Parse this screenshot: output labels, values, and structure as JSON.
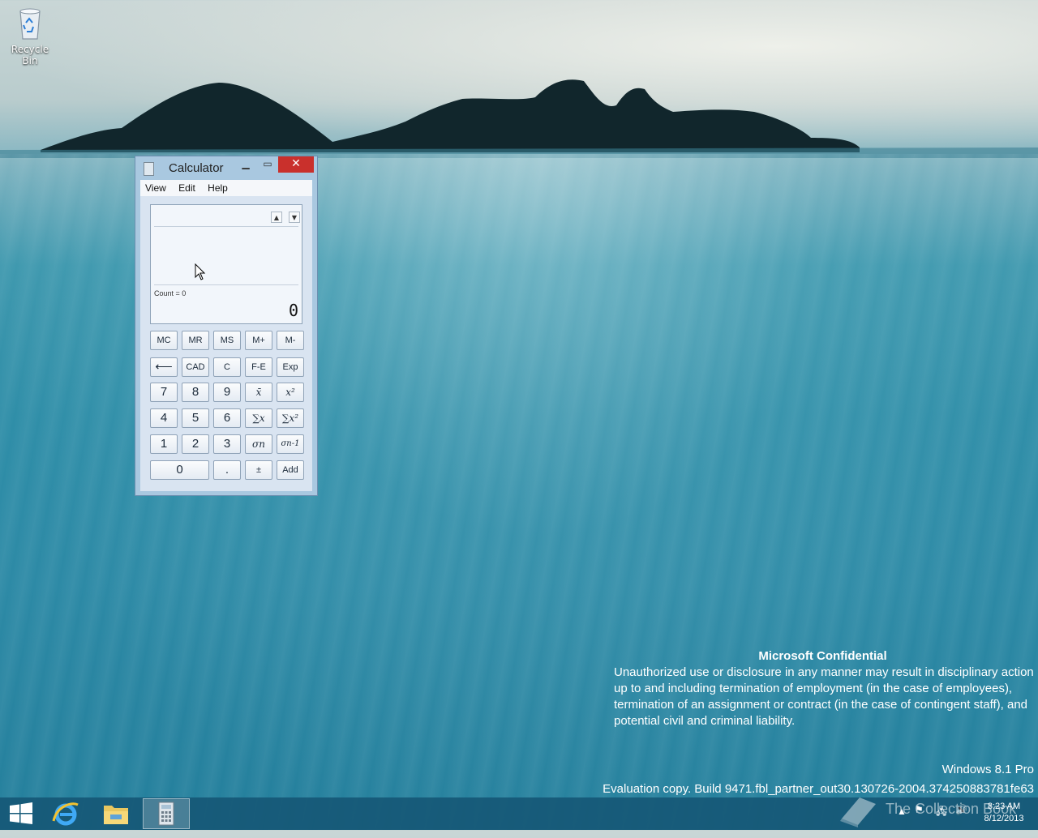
{
  "desktop": {
    "icons": [
      {
        "label": "Recycle Bin",
        "icon": "recycle-bin-icon"
      }
    ]
  },
  "calculator": {
    "title": "Calculator",
    "menu": [
      "View",
      "Edit",
      "Help"
    ],
    "display": {
      "count_text": "Count = 0",
      "value": "0"
    },
    "keys": {
      "row1": [
        "MC",
        "MR",
        "MS",
        "M+",
        "M-"
      ],
      "row2": [
        "⟵",
        "CAD",
        "C",
        "F-E",
        "Exp"
      ],
      "row3": [
        "7",
        "8",
        "9",
        "x̄",
        "x²"
      ],
      "row4": [
        "4",
        "5",
        "6",
        "∑x",
        "∑x²"
      ],
      "row5": [
        "1",
        "2",
        "3",
        "σn",
        "σn-1"
      ],
      "row6": [
        "0",
        ".",
        "±",
        "Add"
      ]
    }
  },
  "notice": {
    "heading": "Microsoft Confidential",
    "body": "Unauthorized use or disclosure in any manner may result in disciplinary action up to and including termination of employment (in the case of employees), termination of an assignment or contract (in the case of contingent staff), and potential civil and criminal liability.",
    "edition": "Windows 8.1 Pro",
    "build": "Evaluation copy. Build 9471.fbl_partner_out30.130726-2004.374250883781fe63"
  },
  "taskbar": {
    "items": [
      {
        "name": "start",
        "icon": "windows-logo-icon"
      },
      {
        "name": "internet-explorer",
        "icon": "ie-icon"
      },
      {
        "name": "file-explorer",
        "icon": "folder-icon"
      },
      {
        "name": "calculator",
        "icon": "calculator-icon",
        "active": true
      }
    ],
    "clock": {
      "time": "8:23 AM",
      "date": "8/12/2013"
    },
    "watermark": "The Collection Book"
  },
  "colors": {
    "close_button": "#c9302c",
    "taskbar": "#165876"
  }
}
